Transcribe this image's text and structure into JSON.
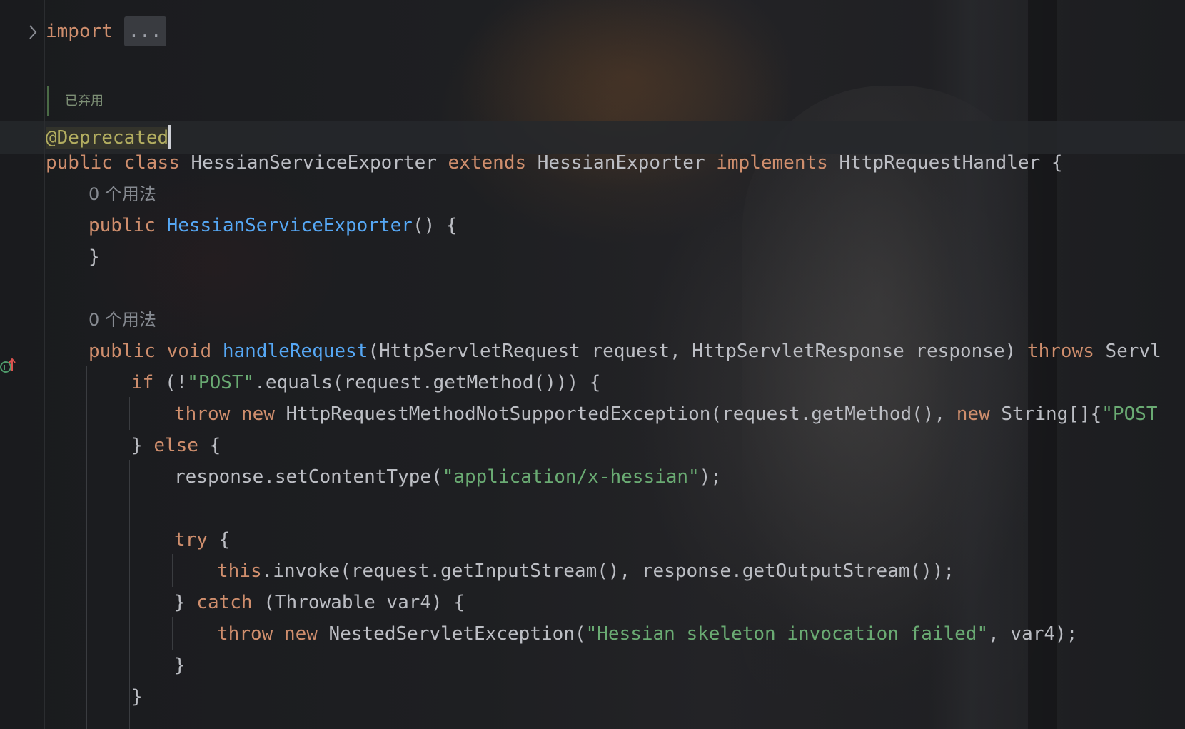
{
  "editor": {
    "fold": {
      "keyword": "import",
      "placeholder": "..."
    },
    "doc_comment": "已弃用",
    "annotation": "@Deprecated",
    "usage_hint_1": "0 个用法",
    "usage_hint_2": "0 个用法",
    "lines": {
      "class_public": "public",
      "class_kw": "class",
      "class_name": "HessianServiceExporter",
      "extends_kw": "extends",
      "super_name": "HessianExporter",
      "implements_kw": "implements",
      "iface_name": "HttpRequestHandler",
      "brace_open": " {",
      "ctor_public": "public",
      "ctor_name": "HessianServiceExporter",
      "ctor_rest": "() {",
      "ctor_close": "}",
      "m_public": "public",
      "m_void": "void",
      "m_name": "handleRequest",
      "m_params": "(HttpServletRequest request, HttpServletResponse response)",
      "m_throws": "throws",
      "m_throws_rest": "Servl",
      "if_kw": "if",
      "if_pre": " (!",
      "if_str": "\"POST\"",
      "if_post": ".equals(request.getMethod())) {",
      "throw1_kw": "throw",
      "throw1_new": "new",
      "throw1_mid": "HttpRequestMethodNotSupportedException(request.getMethod(), ",
      "throw1_new2": "new",
      "throw1_tail": " String[]{",
      "throw1_str": "\"POST",
      "else_pre": "} ",
      "else_kw": "else",
      "else_post": " {",
      "set_pre": "response.setContentType(",
      "set_str": "\"application/x-hessian\"",
      "set_post": ");",
      "try_kw": "try",
      "try_post": " {",
      "this_kw": "this",
      "invoke_rest": ".invoke(request.getInputStream(), response.getOutputStream());",
      "catch_pre": "} ",
      "catch_kw": "catch",
      "catch_post": " (Throwable var4) {",
      "throw2_kw": "throw",
      "throw2_new": "new",
      "throw2_mid": " NestedServletException(",
      "throw2_str": "\"Hessian skeleton invocation failed\"",
      "throw2_post": ", var4);",
      "close_catch": "}",
      "close_else": "}"
    }
  },
  "colors": {
    "keyword": "#cf8e6d",
    "function": "#56a8f5",
    "string": "#6aab73",
    "annotation": "#b3ae60",
    "text": "#bcbec4"
  },
  "icons": {
    "fold": "chevron-right-icon",
    "gutter": "implementing-method-icon"
  }
}
